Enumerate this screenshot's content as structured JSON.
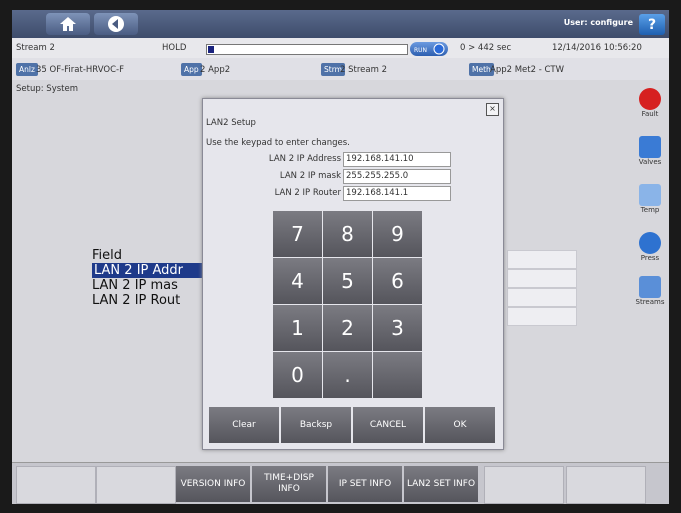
{
  "header": {
    "home_icon": "home-icon",
    "back_icon": "back-arrow-icon",
    "user": "User: configure",
    "help": "?"
  },
  "status": {
    "stream": "Stream 2",
    "hold": "HOLD",
    "hold_progress": 0.03,
    "run_label": "RUN",
    "time": "0 > 442 sec",
    "datetime": "12/14/2016 10:56:20"
  },
  "info": {
    "anlz_tag": "Anlz",
    "anlz": "35 OF-Firat-HRVOC-F",
    "app_tag": "App",
    "app": "2 App2",
    "strm_tag": "Strm",
    "strm": "2 Stream 2",
    "meth_tag": "Meth",
    "meth": "App2 Met2 - CTW"
  },
  "page": {
    "setup_label": "Setup: System"
  },
  "table": {
    "header": "Field",
    "rows": [
      "LAN 2 IP Addr",
      "LAN 2 IP mas",
      "LAN 2 IP Rout"
    ]
  },
  "sidebar": {
    "items": [
      {
        "label": "Fault",
        "icon": "fault-icon"
      },
      {
        "label": "Valves",
        "icon": "valves-icon"
      },
      {
        "label": "Temp",
        "icon": "temp-icon"
      },
      {
        "label": "Press",
        "icon": "press-icon"
      },
      {
        "label": "Streams",
        "icon": "streams-icon"
      }
    ]
  },
  "dialog": {
    "close": "×",
    "title": "LAN2 Setup",
    "instruction": "Use the keypad to enter changes.",
    "fields": [
      {
        "label": "LAN 2 IP Address",
        "value": "192.168.141.10"
      },
      {
        "label": "LAN 2 IP mask",
        "value": "255.255.255.0"
      },
      {
        "label": "LAN 2 IP Router",
        "value": "192.168.141.1"
      }
    ],
    "keys": [
      "7",
      "8",
      "9",
      "4",
      "5",
      "6",
      "1",
      "2",
      "3",
      "0",
      ".",
      ""
    ],
    "actions": [
      "Clear",
      "Backsp",
      "CANCEL",
      "OK"
    ]
  },
  "bottom": {
    "buttons": [
      "VERSION INFO",
      "TIME+DISP INFO",
      "IP SET INFO",
      "LAN2 SET INFO"
    ]
  },
  "colors": {
    "accent": "#4f72a8",
    "selection": "#1e3a8a",
    "fault": "#d62020"
  }
}
